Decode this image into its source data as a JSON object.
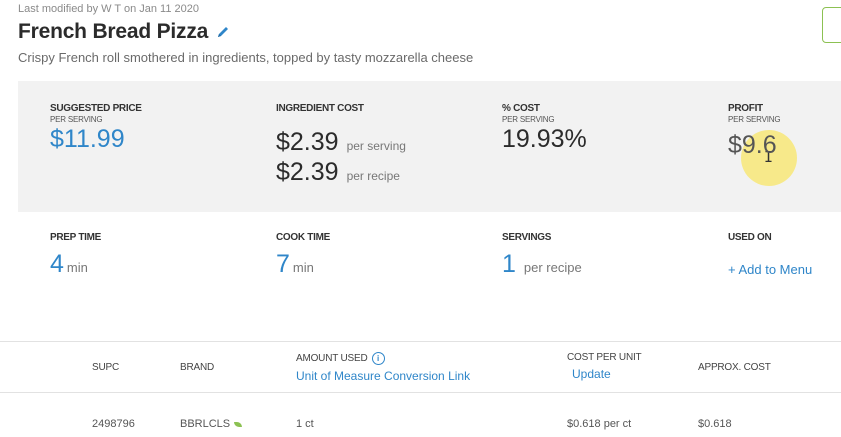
{
  "header": {
    "last_modified": "Last modified by W T on Jan 11 2020",
    "title": "French Bread Pizza",
    "description": "Crispy French roll smothered in ingredients, topped by tasty mozzarella cheese"
  },
  "stats": {
    "suggested_price": {
      "label": "SUGGESTED PRICE",
      "sublabel": "PER SERVING",
      "value": "$11.99"
    },
    "ingredient_cost": {
      "label": "INGREDIENT COST",
      "per_serving_value": "$2.39",
      "per_serving_unit": "per serving",
      "per_recipe_value": "$2.39",
      "per_recipe_unit": "per recipe"
    },
    "percent_cost": {
      "label": "% COST",
      "sublabel": "PER SERVING",
      "value": "19.93%"
    },
    "profit": {
      "label": "PROFIT",
      "sublabel": "PER SERVING",
      "value": "$9.6"
    }
  },
  "details": {
    "prep_time": {
      "label": "PREP TIME",
      "value": "4",
      "unit": "min"
    },
    "cook_time": {
      "label": "COOK TIME",
      "value": "7",
      "unit": "min"
    },
    "servings": {
      "label": "SERVINGS",
      "value": "1",
      "unit": "per recipe"
    },
    "used_on": {
      "label": "USED ON",
      "link": "+ Add to Menu"
    }
  },
  "table": {
    "headers": {
      "supc": "SUPC",
      "brand": "BRAND",
      "amount_used": "AMOUNT USED",
      "amount_link": "Unit of Measure Conversion Link",
      "cost_per_unit": "COST PER UNIT",
      "cost_link": "Update",
      "approx_cost": "APPROX. COST"
    },
    "rows": [
      {
        "supc": "2498796",
        "brand": "BBRLCLS",
        "amount": "1 ct",
        "cost_per_unit": "$0.618 per ct",
        "approx_cost": "$0.618"
      }
    ]
  },
  "icons": {
    "edit": "pencil-icon",
    "info": "info-icon",
    "brand_mark": "leaf-icon"
  },
  "colors": {
    "accent": "#2f86c9",
    "panel": "#f2f2f2",
    "green": "#8cc152"
  }
}
